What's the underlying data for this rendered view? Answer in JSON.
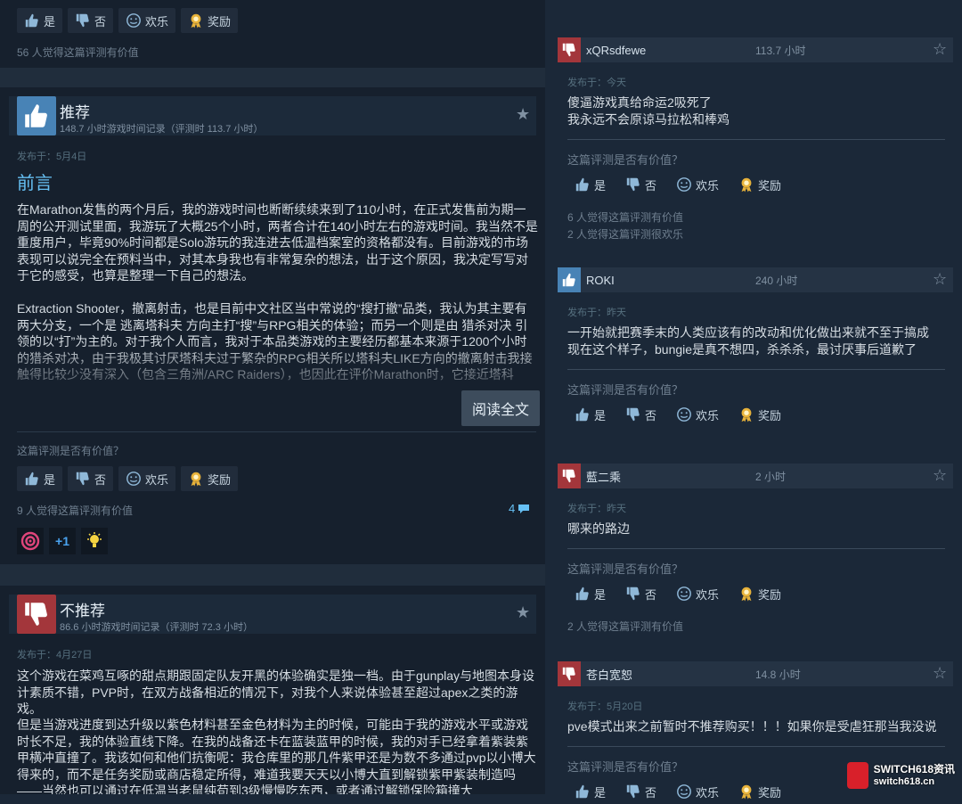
{
  "vote_labels": {
    "yes": "是",
    "no": "否",
    "funny": "欢乐",
    "award": "奖励"
  },
  "top_partial": {
    "helpful": "56 人觉得这篇评测有价值"
  },
  "review1": {
    "verdict": "推荐",
    "hours": "148.7 小时游戏时间记录（评测时 113.7 小时）",
    "posted": "发布于：5月4日",
    "heading": "前言",
    "para1": "在Marathon发售的两个月后，我的游戏时间也断断续续来到了110小时，在正式发售前为期一周的公开测试里面，我游玩了大概25个小时，两者合计在140小时左右的游戏时间。我当然不是重度用户，毕竟90%时间都是Solo游玩的我连进去低温档案室的资格都没有。目前游戏的市场表现可以说完全在预料当中，对其本身我也有非常复杂的想法，出于这个原因，我决定写写对于它的感受，也算是整理一下自己的想法。",
    "para2": "Extraction Shooter，撤离射击，也是目前中文社区当中常说的“搜打撤”品类，我认为其主要有两大分支，一个是 逃离塔科夫 方向主打“搜”与RPG相关的体验；而另一个则是由 猎杀对决 引领的以“打”为主的。对于我个人而言，我对于本品类游戏的主要经历都基本来源于1200个小时的猎杀对决，由于我极其讨厌塔科夫过于繁杂的RPG相关所以塔科夫LIKE方向的撤离射击我接触得比较少没有深入（包含三角洲/ARC Raiders），也因此在评价Marathon时，它接近塔科",
    "read_more": "阅读全文",
    "question": "这篇评测是否有价值？",
    "helpful": "9 人觉得这篇评测有价值",
    "comments": "4",
    "awards": [
      "target-award-icon",
      "plus-one-award-icon",
      "lightbulb-award-icon"
    ]
  },
  "review2": {
    "verdict": "不推荐",
    "hours": "86.6 小时游戏时间记录（评测时 72.3 小时）",
    "posted": "发布于：4月27日",
    "para1": "这个游戏在菜鸡互啄的甜点期跟固定队友开黑的体验确实是独一档。由于gunplay与地图本身设计素质不错，PVP时，在双方战备相近的情况下，对我个人来说体验甚至超过apex之类的游戏。",
    "para2": "但是当游戏进度到达升级以紫色材料甚至金色材料为主的时候，可能由于我的游戏水平或游戏时长不足，我的体验直线下降。在我的战备还卡在蓝装蓝甲的时候，我的对手已经拿着紫装紫甲横冲直撞了。我该如何和他们抗衡呢：我仓库里的那几件紫甲还是为数不多通过pvp以小博大得来的，而不是任务奖励或商店稳定所得，难道我要天天以小博大直到解锁紫甲紫装制造吗——当然也可以通过在低温当老鼠纯苟到3级慢慢吃东西，或者通过解锁保险箱撞大"
  },
  "comments_side": [
    {
      "name": "xQRsdfewe",
      "hours": "113.7 小时",
      "rec": "down",
      "posted": "发布于：今天",
      "lines": [
        "傻逼游戏真给命运2吸死了",
        "我永远不会原谅马拉松和棒鸡"
      ],
      "question": "这篇评测是否有价值？",
      "stats": [
        "6 人觉得这篇评测有价值",
        "2 人觉得这篇评测很欢乐"
      ]
    },
    {
      "name": "ROKI",
      "hours": "240 小时",
      "rec": "up",
      "posted": "发布于：昨天",
      "lines": [
        "一开始就把赛季末的人类应该有的改动和优化做出来就不至于搞成",
        "现在这个样子，bungie是真不想四，杀杀杀，最讨厌事后道歉了"
      ],
      "question": "这篇评测是否有价值？",
      "stats": []
    },
    {
      "name": "藍二乘",
      "hours": "2 小时",
      "rec": "down",
      "posted": "发布于：昨天",
      "lines": [
        "哪来的路边"
      ],
      "question": "这篇评测是否有价值？",
      "stats": [
        "2 人觉得这篇评测有价值"
      ]
    },
    {
      "name": "苍白宽恕",
      "hours": "14.8 小时",
      "rec": "down",
      "posted": "发布于：5月20日",
      "lines": [
        "pve模式出来之前暂时不推荐购买！！！如果你是受虐狂那当我没说"
      ],
      "question": "这篇评测是否有价值？",
      "stats": []
    }
  ],
  "watermark": {
    "line1": "SWITCH618资讯",
    "line2": "switch618.cn"
  },
  "colors": {
    "recommend": "#4883b6",
    "not_recommend": "#a3363b",
    "background": "#1b2838"
  }
}
